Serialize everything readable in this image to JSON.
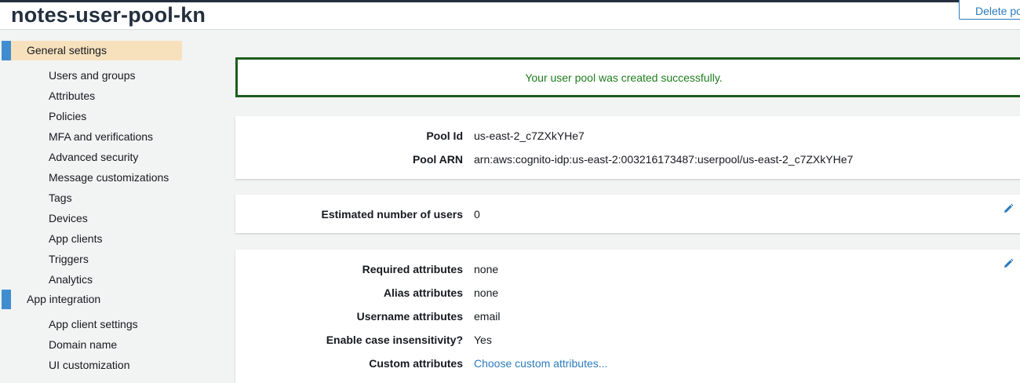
{
  "header": {
    "title": "notes-user-pool-kn",
    "delete_label": "Delete po"
  },
  "sidebar": {
    "sections": [
      {
        "label": "General settings",
        "items": [
          "Users and groups",
          "Attributes",
          "Policies",
          "MFA and verifications",
          "Advanced security",
          "Message customizations",
          "Tags",
          "Devices",
          "App clients",
          "Triggers",
          "Analytics"
        ]
      },
      {
        "label": "App integration",
        "items": [
          "App client settings",
          "Domain name",
          "UI customization"
        ]
      }
    ]
  },
  "main": {
    "success_message": "Your user pool was created successfully.",
    "pool_card": {
      "pool_id_label": "Pool Id",
      "pool_id_value": "us-east-2_c7ZXkYHe7",
      "pool_arn_label": "Pool ARN",
      "pool_arn_value": "arn:aws:cognito-idp:us-east-2:003216173487:userpool/us-east-2_c7ZXkYHe7"
    },
    "users_card": {
      "label": "Estimated number of users",
      "value": "0"
    },
    "attributes_card": {
      "required_label": "Required attributes",
      "required_value": "none",
      "alias_label": "Alias attributes",
      "alias_value": "none",
      "username_label": "Username attributes",
      "username_value": "email",
      "case_label": "Enable case insensitivity?",
      "case_value": "Yes",
      "custom_label": "Custom attributes",
      "custom_link": "Choose custom attributes..."
    }
  },
  "colors": {
    "accent": "#3f8dd0",
    "active_section_bg": "#f7e1bd",
    "success_border": "#1d5d1d",
    "success_text": "#1d7c1d",
    "link": "#2b7bbd"
  },
  "icons": {
    "edit": "pencil-icon"
  }
}
